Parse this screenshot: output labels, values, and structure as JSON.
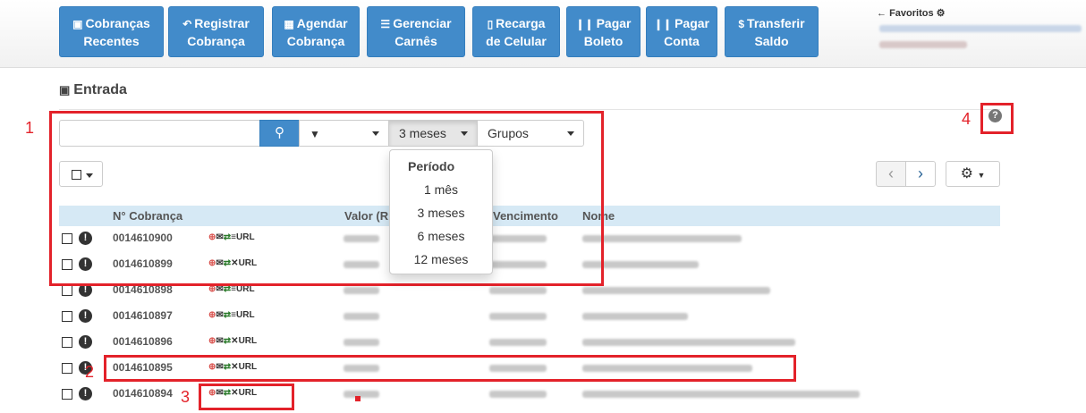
{
  "toolbar": {
    "buttons": [
      {
        "icon": "inbox-icon",
        "line1": "Cobranças",
        "line2": "Recentes"
      },
      {
        "icon": "reply-icon",
        "line1": "Registrar",
        "line2": "Cobrança"
      },
      {
        "icon": "calendar-icon",
        "line1": "Agendar",
        "line2": "Cobrança"
      },
      {
        "icon": "list-icon",
        "line1": "Gerenciar",
        "line2": "Carnês"
      },
      {
        "icon": "mobile-icon",
        "line1": "Recarga",
        "line2": "de Celular"
      },
      {
        "icon": "barcode-icon",
        "line1": "Pagar",
        "line2": "Boleto"
      },
      {
        "icon": "barcode-icon",
        "line1": "Pagar",
        "line2": "Conta"
      },
      {
        "icon": "dollar-icon",
        "line1": "Transferir",
        "line2": "Saldo"
      }
    ],
    "favorites_label": "Favoritos"
  },
  "inbox": {
    "title": "Entrada",
    "search": {
      "value": "",
      "placeholder": ""
    },
    "period_selected": "3 meses",
    "groups_label": "Grupos",
    "period_menu": {
      "header": "Período",
      "options": [
        "1 mês",
        "3 meses",
        "6 meses",
        "12 meses"
      ]
    }
  },
  "table": {
    "columns": [
      "N° Cobrança",
      "Valor (R",
      "Vencimento",
      "Nome"
    ],
    "rows": [
      {
        "number": "0014610900",
        "actions": "URL"
      },
      {
        "number": "0014610899",
        "actions": "URL"
      },
      {
        "number": "0014610898",
        "actions": "URL"
      },
      {
        "number": "0014610897",
        "actions": "URL"
      },
      {
        "number": "0014610896",
        "actions": "URL"
      },
      {
        "number": "0014610895",
        "actions": "URL"
      },
      {
        "number": "0014610894",
        "actions": "URL"
      }
    ]
  },
  "annotations": {
    "n1": "1",
    "n2": "2",
    "n3": "3",
    "n4": "4"
  },
  "colors": {
    "primary": "#428bca",
    "annotation": "#e3222a",
    "table_header": "#d6e9f5"
  }
}
